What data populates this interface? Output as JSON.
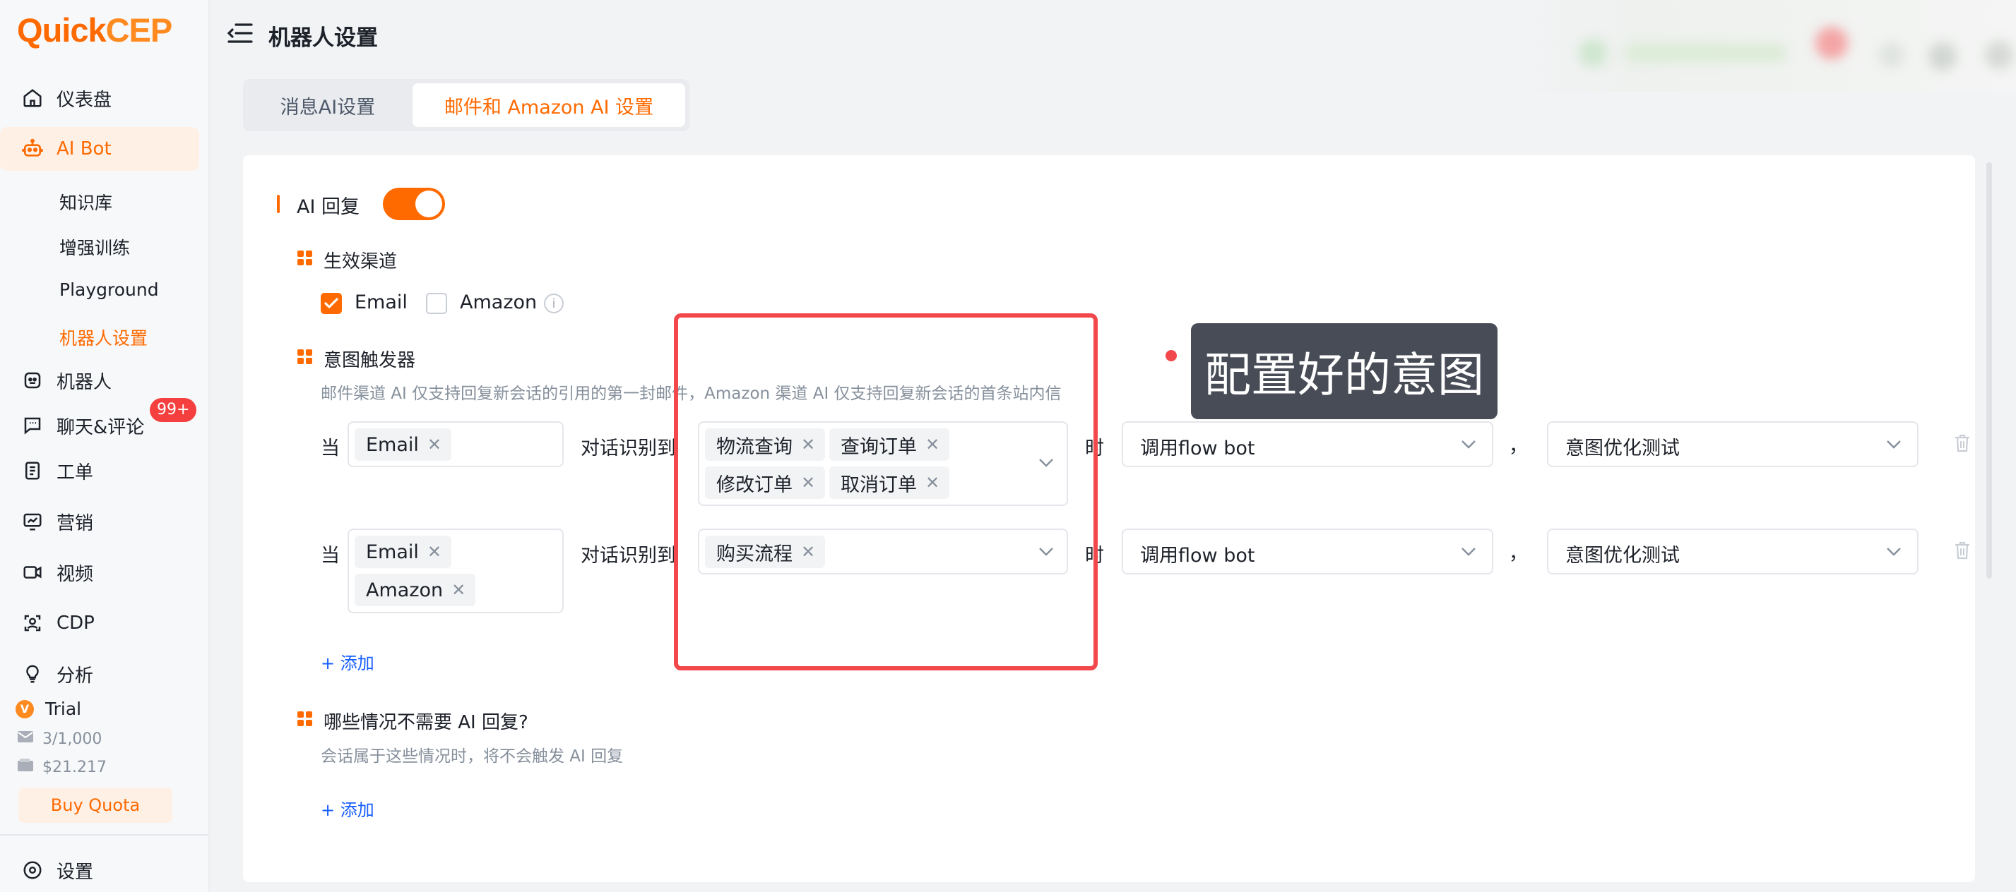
{
  "app": {
    "logo_q": "Q",
    "logo_uick": "uick",
    "logo_cep": "CEP"
  },
  "sidebar": {
    "items": [
      {
        "label": "仪表盘",
        "icon": "home-icon"
      },
      {
        "label": "AI Bot",
        "icon": "robot-icon"
      },
      {
        "label": "机器人",
        "icon": "bot-face-icon"
      },
      {
        "label": "聊天&评论",
        "icon": "chat-icon"
      },
      {
        "label": "工单",
        "icon": "ticket-icon"
      },
      {
        "label": "营销",
        "icon": "marketing-icon"
      },
      {
        "label": "视频",
        "icon": "video-icon"
      },
      {
        "label": "CDP",
        "icon": "cdp-icon"
      },
      {
        "label": "分析",
        "icon": "bulb-icon"
      }
    ],
    "ai_bot_subitems": [
      "知识库",
      "增强训练",
      "Playground",
      "机器人设置"
    ],
    "chat_badge": "99+",
    "trial_label": "Trial",
    "trial_badge": "V",
    "usage_count": "3/1,000",
    "balance": "$21.217",
    "buy_quota": "Buy Quota",
    "settings": "设置"
  },
  "header": {
    "title": "机器人设置"
  },
  "tabs": [
    {
      "label": "消息AI设置",
      "active": false
    },
    {
      "label": "邮件和 Amazon AI 设置",
      "active": true
    }
  ],
  "ai_reply": {
    "title": "AI 回复",
    "enabled": true,
    "channels": {
      "title": "生效渠道",
      "options": [
        {
          "label": "Email",
          "checked": true
        },
        {
          "label": "Amazon",
          "checked": false
        }
      ]
    },
    "intent_trigger": {
      "title": "意图触发器",
      "hint": "邮件渠道 AI 仅支持回复新会话的引用的第一封邮件，Amazon 渠道 AI 仅支持回复新会话的首条站内信",
      "when_label": "当",
      "recognize_label": "对话识别到",
      "time_label": "时",
      "comma": "，",
      "rules": [
        {
          "channels": [
            "Email"
          ],
          "intents": [
            "物流查询",
            "查询订单",
            "修改订单",
            "取消订单"
          ],
          "action": "调用flow bot",
          "bot": "意图优化测试"
        },
        {
          "channels": [
            "Email",
            "Amazon"
          ],
          "intents": [
            "购买流程"
          ],
          "action": "调用flow bot",
          "bot": "意图优化测试"
        }
      ],
      "add_label": "+ 添加"
    },
    "exclusions": {
      "title": "哪些情况不需要 AI 回复?",
      "hint": "会话属于这些情况时，将不会触发 AI 回复",
      "add_label": "+ 添加"
    }
  },
  "annotation": {
    "callout": "配置好的意图"
  },
  "colors": {
    "accent": "#ff6a00",
    "link": "#165dff",
    "annotation_red": "#f2474b",
    "callout_bg": "#474c56"
  }
}
